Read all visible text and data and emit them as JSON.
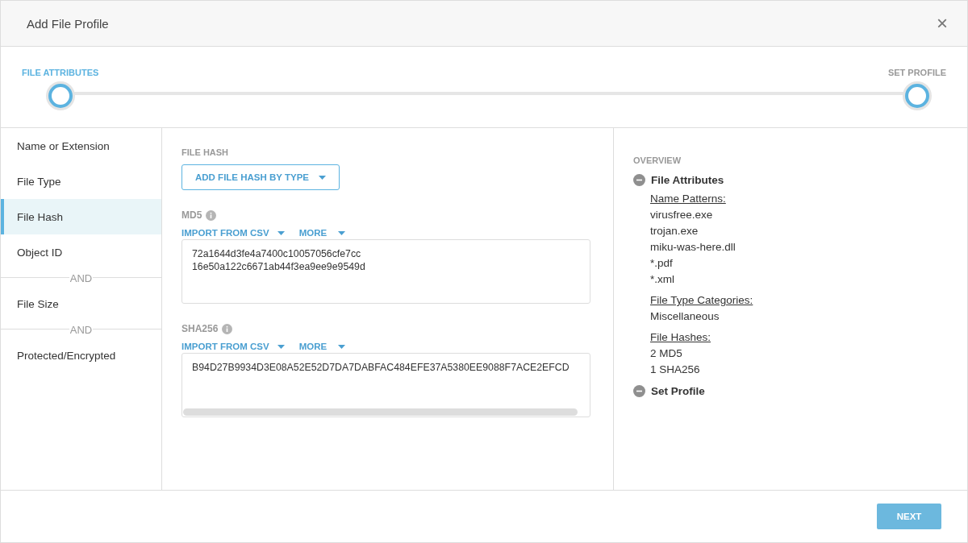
{
  "dialog": {
    "title": "Add File Profile",
    "close": "×"
  },
  "steps": [
    {
      "label": "FILE ATTRIBUTES",
      "selected": true
    },
    {
      "label": "SET PROFILE",
      "selected": false
    }
  ],
  "sidebar": {
    "items": [
      {
        "kind": "item",
        "label": "Name or Extension",
        "selected": false
      },
      {
        "kind": "item",
        "label": "File Type",
        "selected": false
      },
      {
        "kind": "item",
        "label": "File Hash",
        "selected": true
      },
      {
        "kind": "item",
        "label": "Object ID",
        "selected": false
      },
      {
        "kind": "separator",
        "label": "AND"
      },
      {
        "kind": "item",
        "label": "File Size",
        "selected": false
      },
      {
        "kind": "separator",
        "label": "AND"
      },
      {
        "kind": "item",
        "label": "Protected/Encrypted",
        "selected": false
      }
    ]
  },
  "file_hash": {
    "heading": "FILE HASH",
    "add_button": "ADD FILE HASH BY TYPE",
    "fields": [
      {
        "label": "MD5",
        "actions": [
          "IMPORT FROM CSV",
          "MORE"
        ],
        "lines": [
          "72a1644d3fe4a7400c10057056cfe7cc",
          "16e50a122c6671ab44f3ea9ee9e9549d"
        ],
        "scrollbar": false
      },
      {
        "label": "SHA256",
        "actions": [
          "IMPORT FROM CSV",
          "MORE"
        ],
        "lines": [
          "B94D27B9934D3E08A52E52D7DA7DABFAC484EFE37A5380EE9088F7ACE2EFCD"
        ],
        "scrollbar": true
      }
    ]
  },
  "overview": {
    "heading": "OVERVIEW",
    "sections": [
      {
        "title": "File Attributes",
        "expanded": true,
        "groups": [
          {
            "heading": "Name Patterns:",
            "values": [
              "virusfree.exe",
              "trojan.exe",
              "miku-was-here.dll",
              "*.pdf",
              "*.xml"
            ]
          },
          {
            "heading": "File Type Categories:",
            "values": [
              "Miscellaneous"
            ]
          },
          {
            "heading": "File Hashes:",
            "values": [
              "2 MD5",
              "1 SHA256"
            ]
          }
        ]
      },
      {
        "title": "Set Profile",
        "expanded": true
      }
    ]
  },
  "footer": {
    "next_button": "NEXT"
  }
}
